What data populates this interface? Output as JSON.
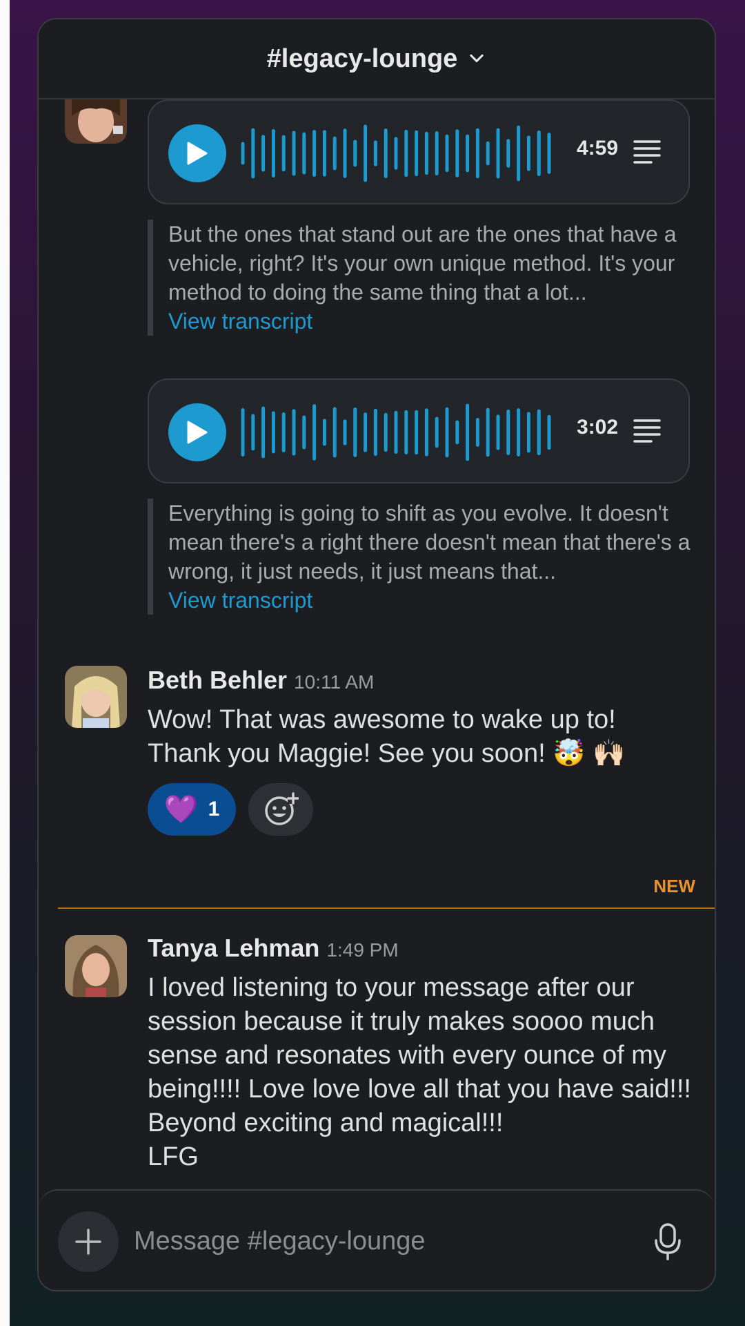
{
  "channel": {
    "name": "#legacy-lounge"
  },
  "audio_clips": [
    {
      "duration": "4:59"
    },
    {
      "duration": "3:02"
    }
  ],
  "transcripts": [
    {
      "text": "But the ones that stand out are the ones that have a vehicle, right? It's your own unique method. It's your method to doing the same thing that a lot...",
      "link": "View transcript"
    },
    {
      "text": "Everything is going to shift as you evolve. It doesn't mean there's a right there doesn't mean that there's a wrong, it just needs, it just means that...",
      "link": "View transcript"
    }
  ],
  "messages": [
    {
      "author": "Beth Behler",
      "time": "10:11 AM",
      "line1": "Wow! That was awesome to wake up to!",
      "line2": "Thank you Maggie! See you soon! 🤯 🙌🏻",
      "reactions": [
        {
          "emoji": "💜",
          "count": "1"
        }
      ]
    },
    {
      "author": "Tanya Lehman",
      "time": "1:49 PM",
      "text": "I loved listening to your message after our session because it truly makes soooo much sense and resonates with every ounce of my being!!!! Love love love all that you have said!!! Beyond exciting and magical!!!",
      "text2": "LFG"
    }
  ],
  "divider": {
    "label": "NEW"
  },
  "composer": {
    "placeholder": "Message #legacy-lounge"
  },
  "colors": {
    "accent": "#1d9bd1",
    "new_divider": "#e8912d",
    "reaction_bg": "#0b4d93"
  }
}
